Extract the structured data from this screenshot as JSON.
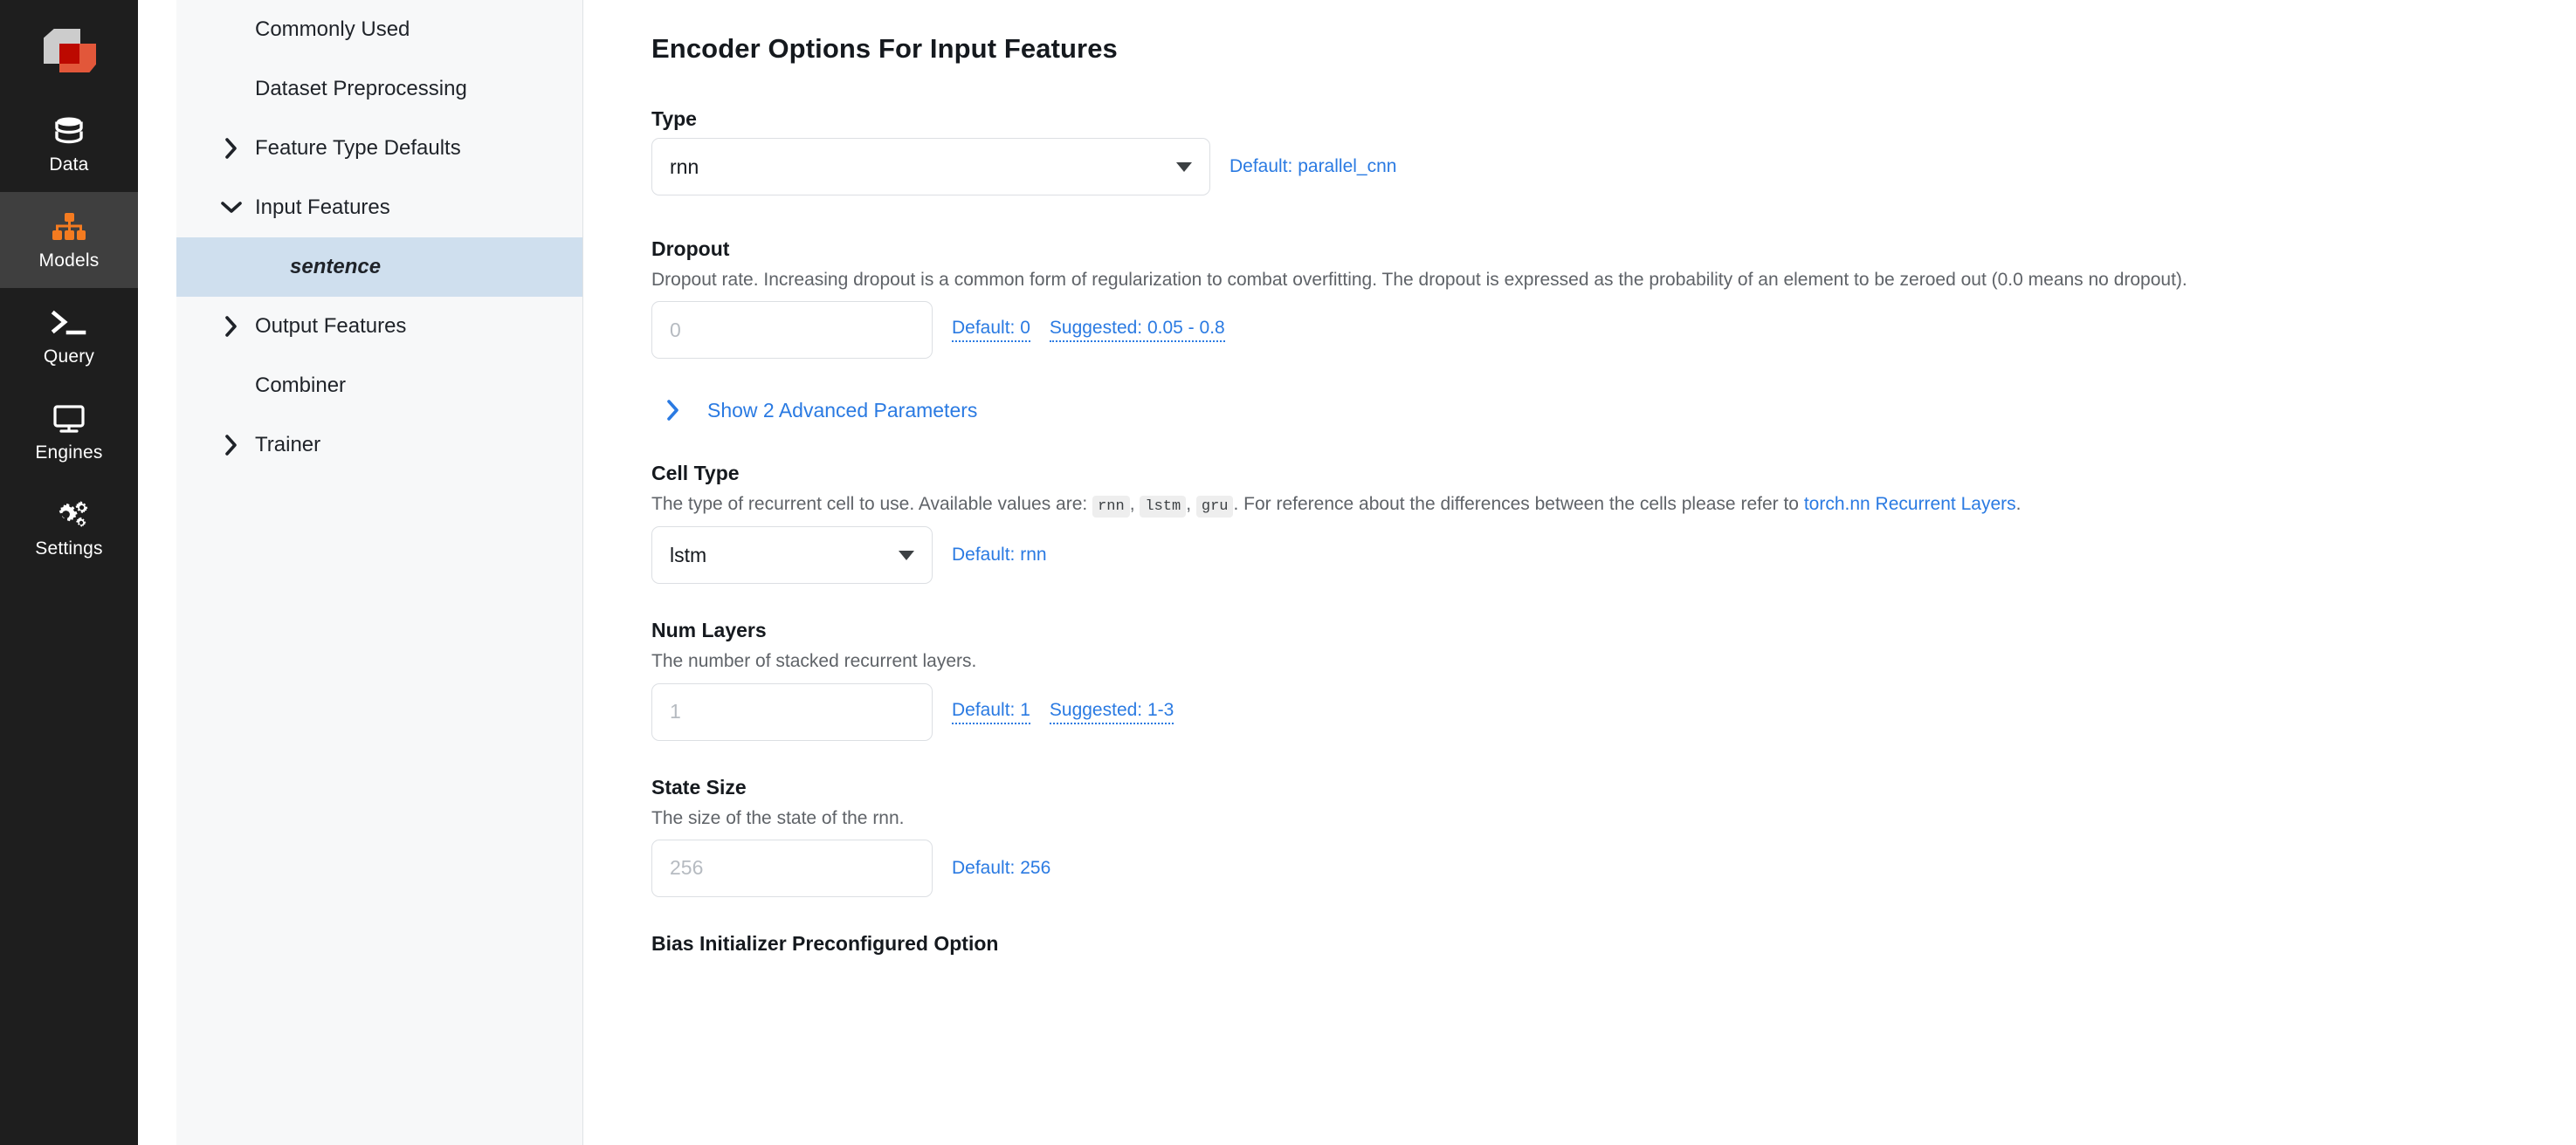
{
  "rail": {
    "logo_name": "predibase-logo",
    "items": [
      {
        "label": "Data",
        "icon": "database-icon",
        "active": false
      },
      {
        "label": "Models",
        "icon": "model-hierarchy-icon",
        "active": true
      },
      {
        "label": "Query",
        "icon": "terminal-prompt-icon",
        "active": false
      },
      {
        "label": "Engines",
        "icon": "monitor-icon",
        "active": false
      },
      {
        "label": "Settings",
        "icon": "gears-icon",
        "active": false
      }
    ],
    "active_color": "#3f3f3f",
    "accent_color": "#f47b20",
    "background": "#1e1e1e"
  },
  "tree": {
    "items": [
      {
        "label": "Commonly Used",
        "level": 0,
        "chevron": "none",
        "selected": false
      },
      {
        "label": "Dataset Preprocessing",
        "level": 0,
        "chevron": "none",
        "selected": false
      },
      {
        "label": "Feature Type Defaults",
        "level": 0,
        "chevron": "right",
        "selected": false
      },
      {
        "label": "Input Features",
        "level": 0,
        "chevron": "down",
        "selected": false
      },
      {
        "label": "sentence",
        "level": 1,
        "chevron": "none",
        "selected": true
      },
      {
        "label": "Output Features",
        "level": 0,
        "chevron": "right",
        "selected": false
      },
      {
        "label": "Combiner",
        "level": 0,
        "chevron": "none",
        "selected": false
      },
      {
        "label": "Trainer",
        "level": 0,
        "chevron": "right",
        "selected": false
      }
    ],
    "selected_color": "#cfdfee"
  },
  "main": {
    "title": "Encoder Options For Input Features",
    "link_color": "#2a7ae2",
    "type": {
      "label": "Type",
      "value": "rnn",
      "default_hint": "Default: parallel_cnn"
    },
    "dropout": {
      "label": "Dropout",
      "description": "Dropout rate. Increasing dropout is a common form of regularization to combat overfitting. The dropout is expressed as the probability of an element to be zeroed out (0.0 means no dropout).",
      "placeholder": "0",
      "value": "",
      "default_hint": "Default: 0",
      "suggested_hint": "Suggested: 0.05 - 0.8"
    },
    "advanced_toggle": {
      "label": "Show 2 Advanced Parameters",
      "expanded": false
    },
    "cell_type": {
      "label": "Cell Type",
      "desc_part1": "The type of recurrent cell to use. Available values are:",
      "tokens": [
        "rnn",
        "lstm",
        "gru"
      ],
      "desc_part2": ". For reference about the differences between the cells please refer to",
      "link_text": "torch.nn Recurrent Layers",
      "desc_part3": ".",
      "value": "lstm",
      "default_hint": "Default: rnn"
    },
    "num_layers": {
      "label": "Num Layers",
      "description": "The number of stacked recurrent layers.",
      "placeholder": "1",
      "value": "",
      "default_hint": "Default: 1",
      "suggested_hint": "Suggested: 1-3"
    },
    "state_size": {
      "label": "State Size",
      "description": "The size of the state of the rnn.",
      "placeholder": "256",
      "value": "",
      "default_hint": "Default: 256"
    },
    "bias_initializer": {
      "label": "Bias Initializer Preconfigured Option"
    }
  }
}
